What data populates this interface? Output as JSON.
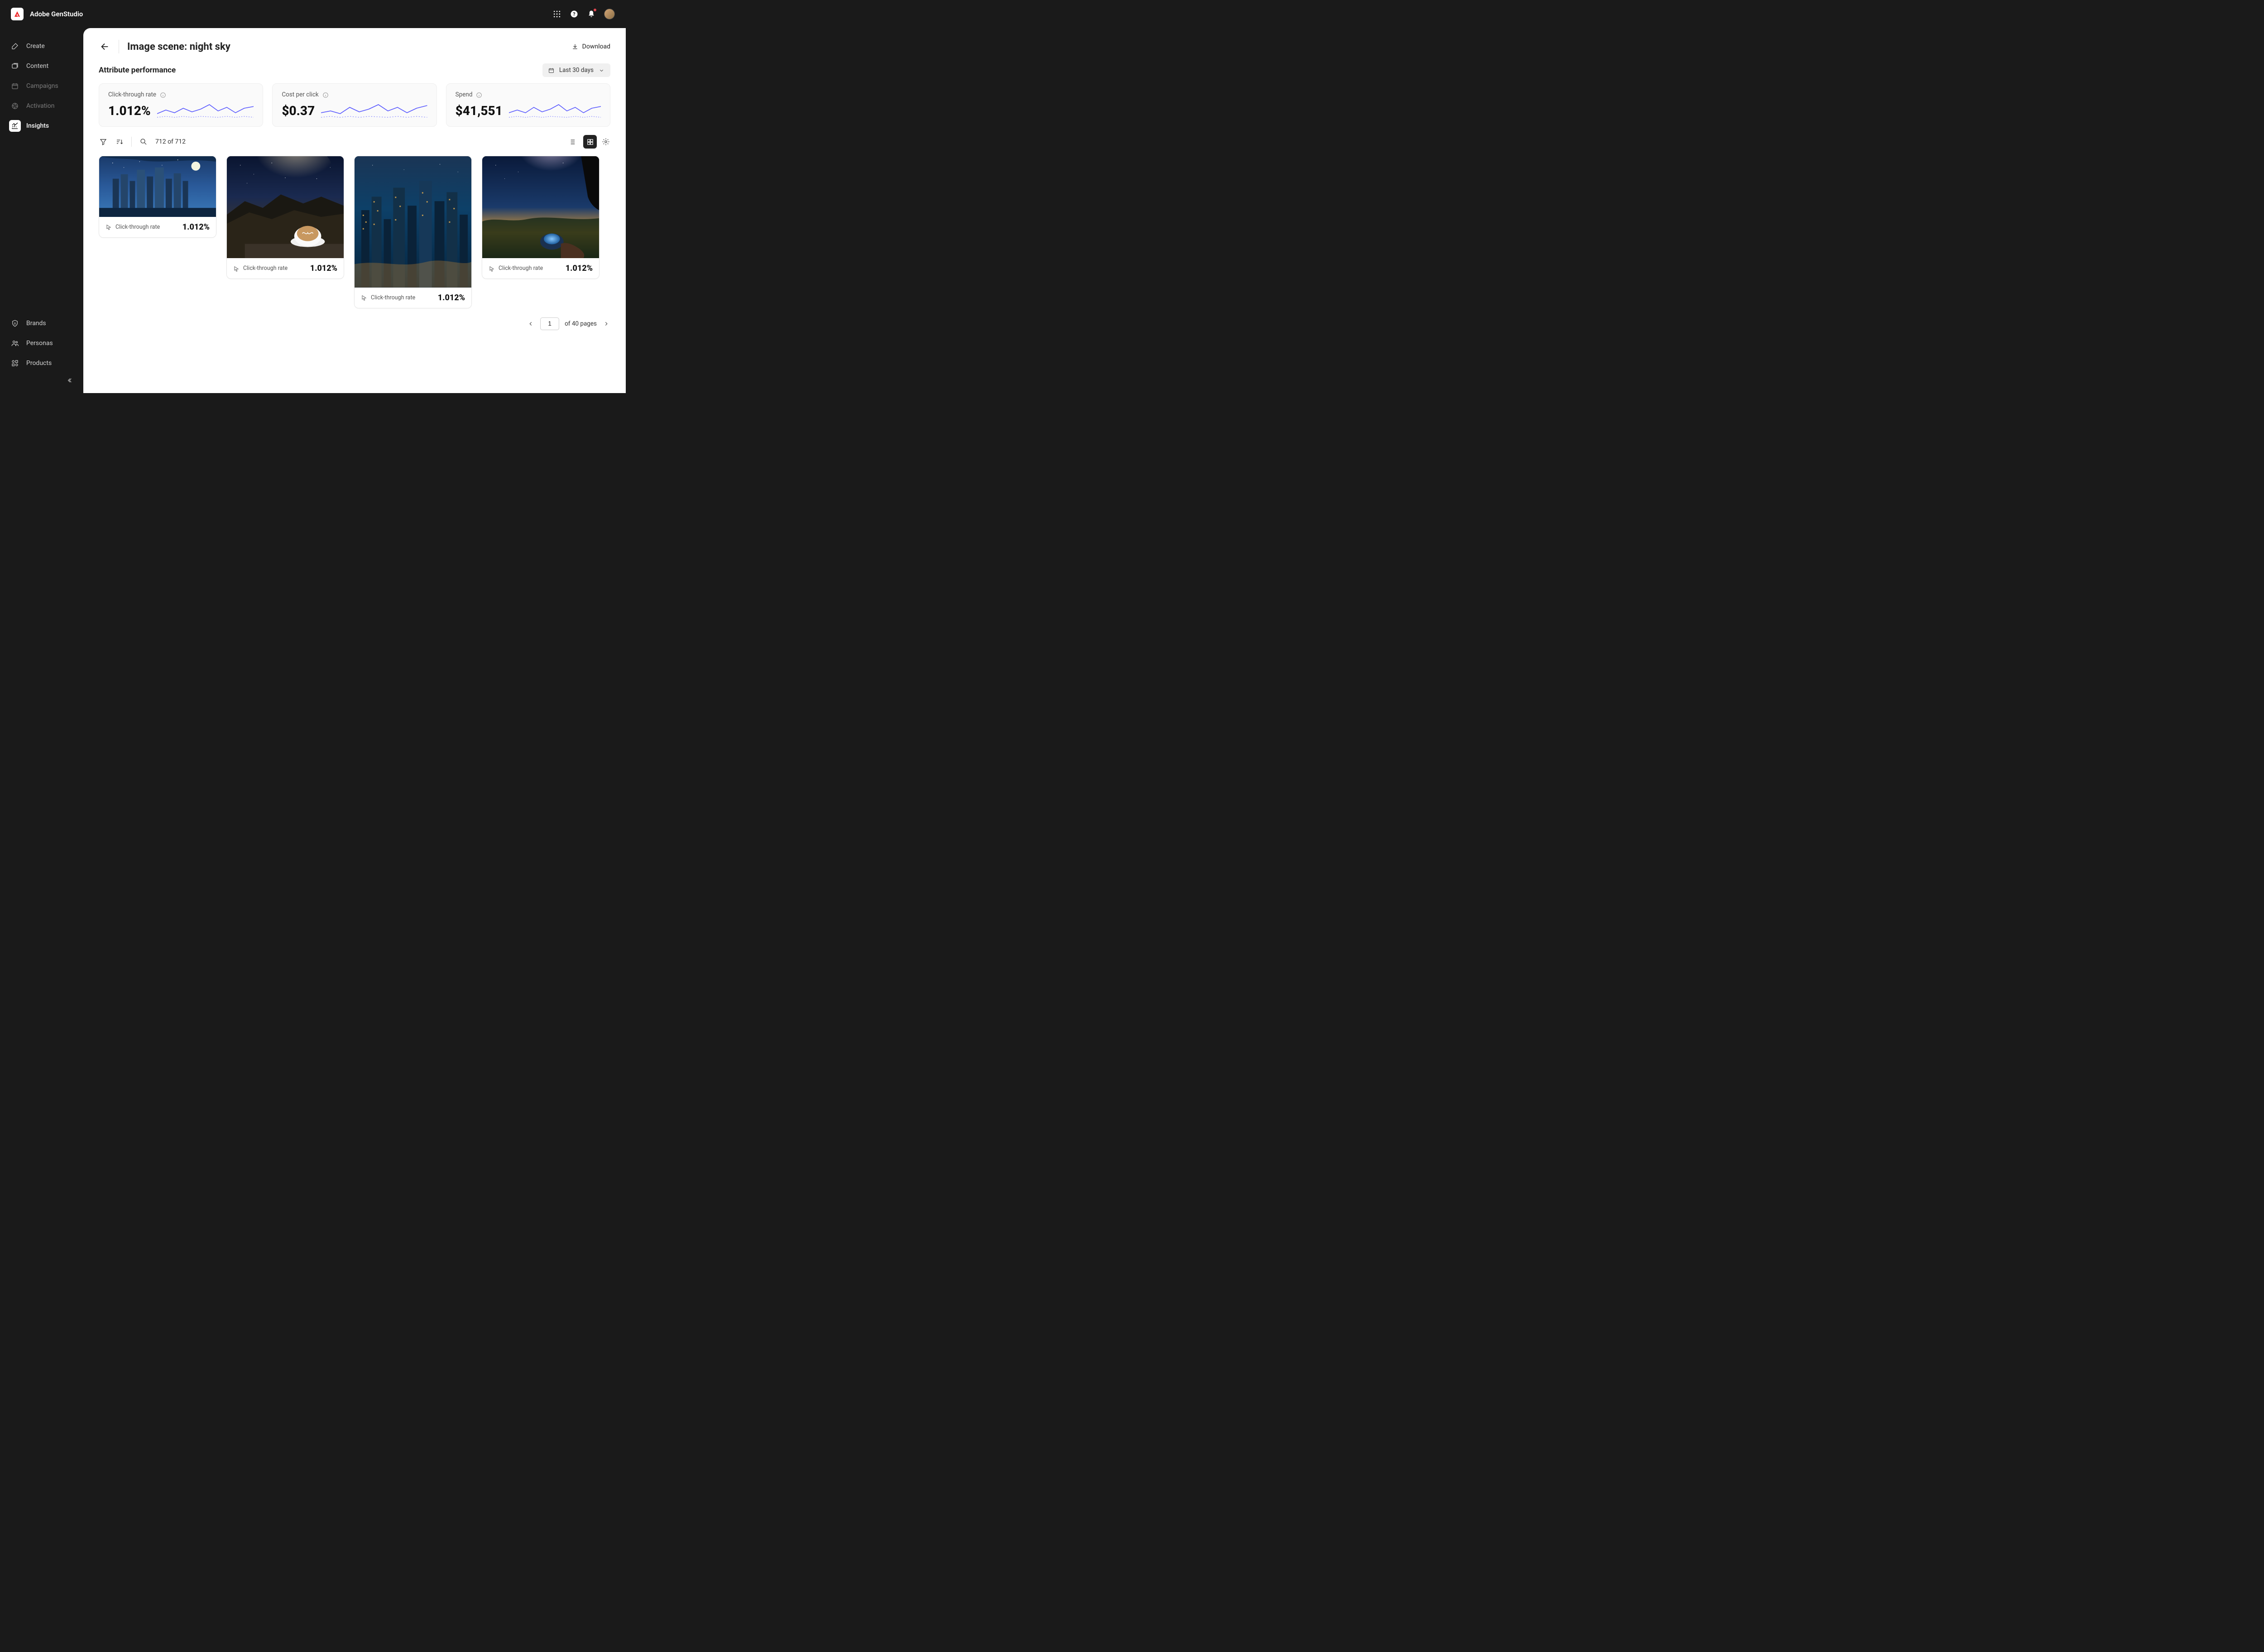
{
  "brand": "Adobe GenStudio",
  "sidebar": {
    "top": [
      {
        "label": "Create"
      },
      {
        "label": "Content"
      },
      {
        "label": "Campaigns"
      },
      {
        "label": "Activation"
      },
      {
        "label": "Insights"
      }
    ],
    "bottom": [
      {
        "label": "Brands"
      },
      {
        "label": "Personas"
      },
      {
        "label": "Products"
      }
    ]
  },
  "page": {
    "title": "Image scene: night sky",
    "download_label": "Download",
    "section_title": "Attribute performance",
    "date_range": "Last 30 days"
  },
  "metrics": [
    {
      "label": "Click-through rate",
      "value": "1.012%"
    },
    {
      "label": "Cost per click",
      "value": "$0.37"
    },
    {
      "label": "Spend",
      "value": "$41,551"
    }
  ],
  "toolbar": {
    "count": "712 of 712"
  },
  "cards": [
    {
      "label": "Click-through rate",
      "value": "1.012%"
    },
    {
      "label": "Click-through rate",
      "value": "1.012%"
    },
    {
      "label": "Click-through rate",
      "value": "1.012%"
    },
    {
      "label": "Click-through rate",
      "value": "1.012%"
    }
  ],
  "pagination": {
    "page": "1",
    "total_label": "of 40 pages"
  }
}
